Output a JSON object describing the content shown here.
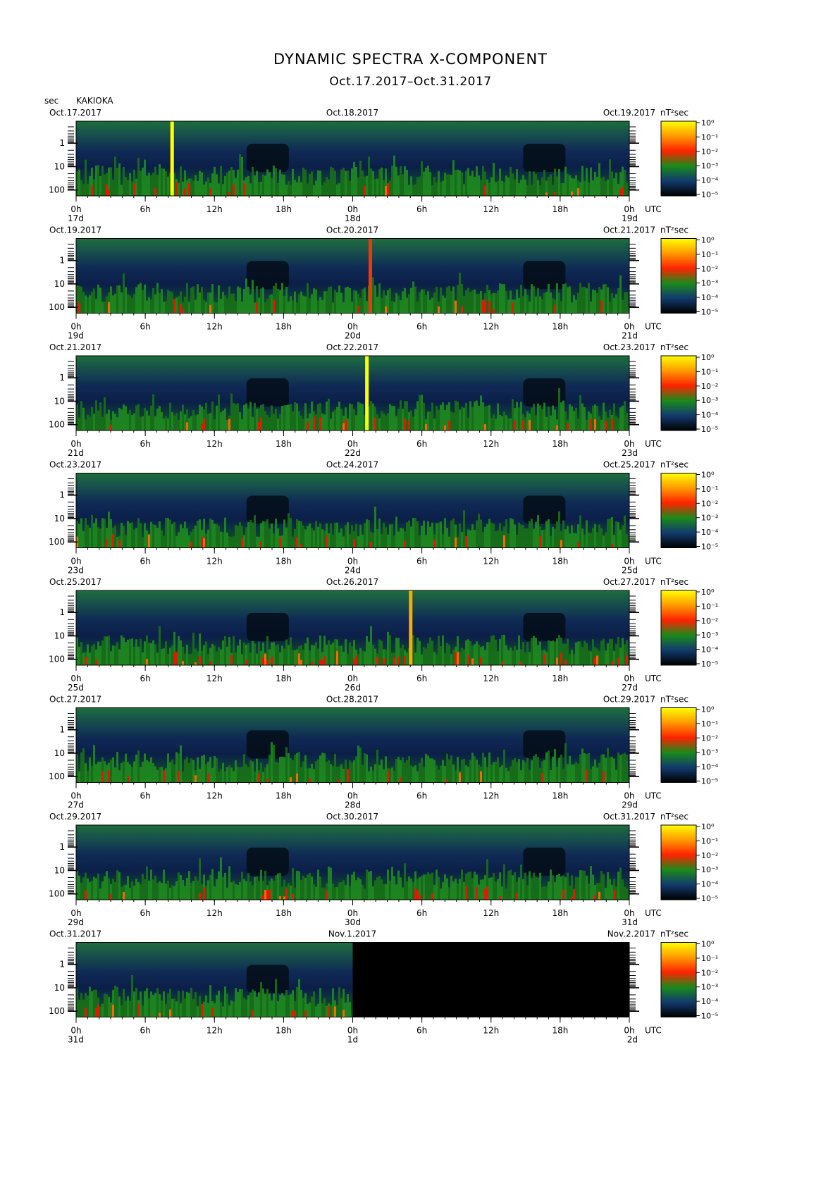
{
  "title": "DYNAMIC SPECTRA X-COMPONENT",
  "subtitle": "Oct.17.2017–Oct.31.2017",
  "y_unit": "sec",
  "station": "KAKIOKA",
  "colorbar_unit": "nT²sec",
  "utc_label": "UTC",
  "chart_data": {
    "type": "heatmap",
    "title": "DYNAMIC SPECTRA X-COMPONENT",
    "subtitle": "Oct.17.2017–Oct.31.2017",
    "ylabel": "sec",
    "y_scale": "log",
    "y_ticks": [
      "1",
      "10",
      "100"
    ],
    "x_ticks": [
      "0h",
      "6h",
      "12h",
      "18h",
      "0h",
      "6h",
      "12h",
      "18h",
      "0h"
    ],
    "colorbar": {
      "label": "nT²sec",
      "ticks": [
        "10⁰",
        "10⁻¹",
        "10⁻²",
        "10⁻³",
        "10⁻⁴",
        "10⁻⁵"
      ],
      "colors": [
        "#ffff00",
        "#ff9900",
        "#ff2200",
        "#1a8a1a",
        "#123a6e",
        "#000000"
      ]
    },
    "panels": [
      {
        "dates": [
          "Oct.17.2017",
          "Oct.18.2017",
          "Oct.19.2017"
        ],
        "days": [
          "17d",
          "18d",
          "19d"
        ],
        "spikes": [
          {
            "hour": 8.3,
            "color": "#ffff00"
          }
        ],
        "active_hours": 48
      },
      {
        "dates": [
          "Oct.19.2017",
          "Oct.20.2017",
          "Oct.21.2017"
        ],
        "days": [
          "19d",
          "20d",
          "21d"
        ],
        "spikes": [
          {
            "hour": 25.5,
            "color": "#ff3300"
          }
        ],
        "active_hours": 48
      },
      {
        "dates": [
          "Oct.21.2017",
          "Oct.22.2017",
          "Oct.23.2017"
        ],
        "days": [
          "21d",
          "22d",
          "23d"
        ],
        "spikes": [
          {
            "hour": 25.2,
            "color": "#ffff00"
          }
        ],
        "active_hours": 48
      },
      {
        "dates": [
          "Oct.23.2017",
          "Oct.24.2017",
          "Oct.25.2017"
        ],
        "days": [
          "23d",
          "24d",
          "25d"
        ],
        "spikes": [],
        "active_hours": 48
      },
      {
        "dates": [
          "Oct.25.2017",
          "Oct.26.2017",
          "Oct.27.2017"
        ],
        "days": [
          "25d",
          "26d",
          "27d"
        ],
        "spikes": [
          {
            "hour": 29.0,
            "color": "#ffaa00"
          }
        ],
        "active_hours": 48
      },
      {
        "dates": [
          "Oct.27.2017",
          "Oct.28.2017",
          "Oct.29.2017"
        ],
        "days": [
          "27d",
          "28d",
          "29d"
        ],
        "spikes": [],
        "active_hours": 48
      },
      {
        "dates": [
          "Oct.29.2017",
          "Oct.30.2017",
          "Oct.31.2017"
        ],
        "days": [
          "29d",
          "30d",
          "31d"
        ],
        "spikes": [],
        "active_hours": 48
      },
      {
        "dates": [
          "Oct.31.2017",
          "Nov.1.2017",
          "Nov.2.2017"
        ],
        "days": [
          "31d",
          "1d",
          "2d"
        ],
        "spikes": [],
        "active_hours": 24
      }
    ]
  }
}
